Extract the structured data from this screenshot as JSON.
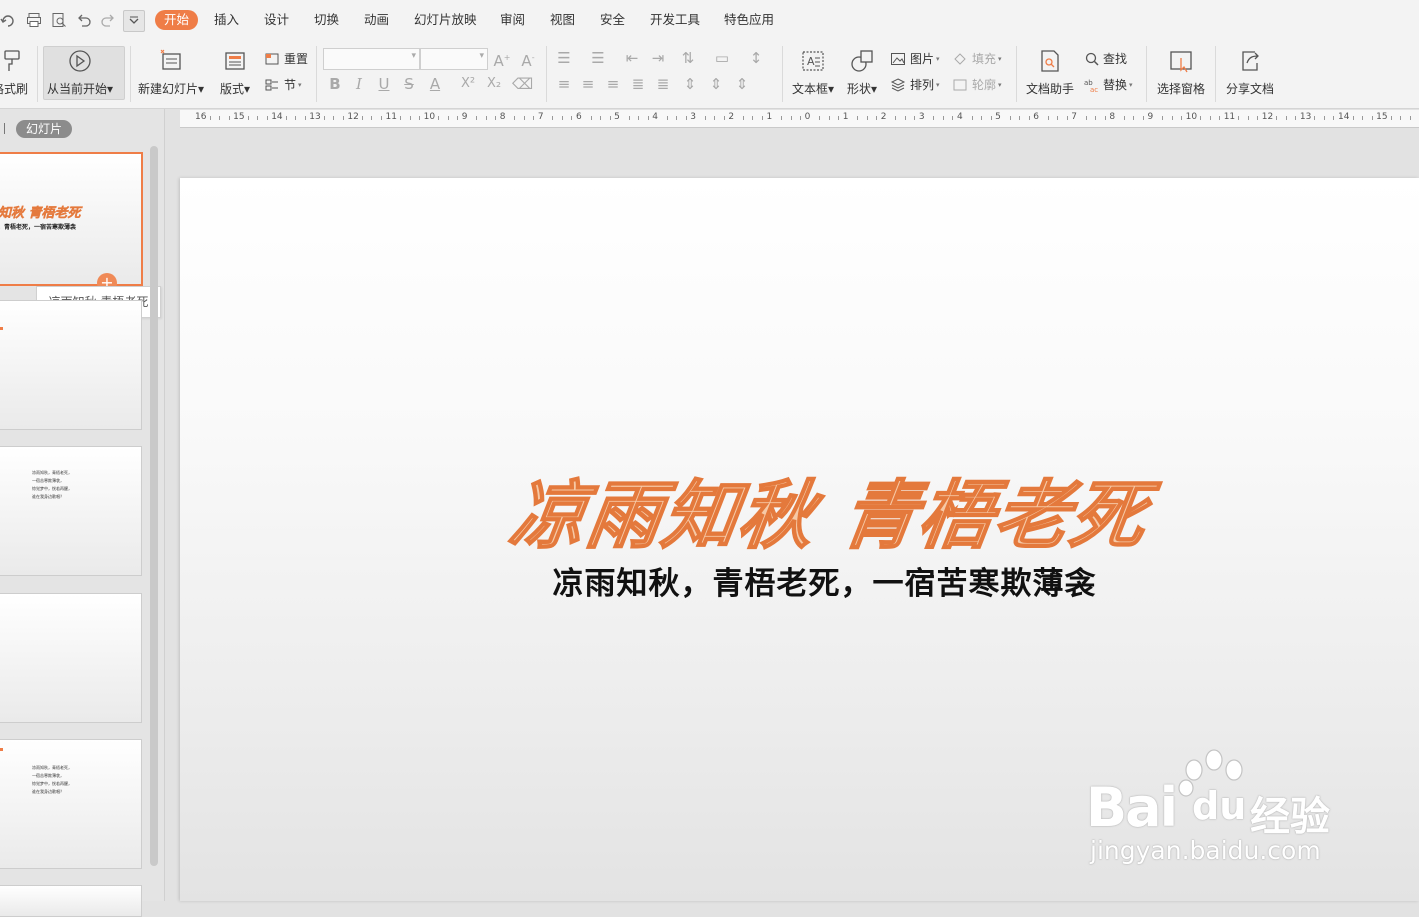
{
  "menubar": {
    "tabs": [
      "开始",
      "插入",
      "设计",
      "切换",
      "动画",
      "幻灯片放映",
      "审阅",
      "视图",
      "安全",
      "开发工具",
      "特色应用"
    ],
    "active_tab": "开始",
    "accent": "#ef7d47"
  },
  "ribbon": {
    "format_painter": "格式刷",
    "from_current": "从当前开始",
    "new_slide": "新建幻灯片",
    "layout": "版式",
    "reset": "重置",
    "section": "节",
    "text_box": "文本框",
    "shape": "形状",
    "picture": "图片",
    "arrange": "排列",
    "fill": "填充",
    "outline": "轮廓",
    "doc_assistant": "文档助手",
    "find": "查找",
    "replace": "替换",
    "selection_pane": "选择窗格",
    "share_doc": "分享文档",
    "font_name": "",
    "font_size": ""
  },
  "panel": {
    "tab_outline": "",
    "tab_slides": "幻灯片",
    "tooltip": "凉雨知秋 青梧老死"
  },
  "thumbnails": {
    "t1_title": "知秋 青梧老死",
    "t1_sub": "，青梧老死，一宿苦寒欺薄衾",
    "list_lines": [
      "凉雨知秋，青梧老死，",
      "一宿苦寒欺薄衾，",
      "惊觉梦中，恍若再醒，",
      "谁在我身边歌唱？"
    ]
  },
  "ruler": {
    "labels": [
      "16",
      "15",
      "14",
      "13",
      "12",
      "11",
      "10",
      "9",
      "8",
      "7",
      "6",
      "5",
      "4",
      "3",
      "2",
      "1",
      "0",
      "1",
      "2",
      "3",
      "4",
      "5",
      "6",
      "7",
      "8",
      "9",
      "10",
      "11",
      "12",
      "13",
      "14",
      "15"
    ]
  },
  "slide": {
    "title": "凉雨知秋 青梧老死",
    "subtitle": "凉雨知秋，青梧老死，一宿苦寒欺薄衾",
    "title_color": "#e4793c"
  },
  "watermark": {
    "brand": "Bai",
    "brand2": "du",
    "cn": "经验",
    "url": "jingyan.baidu.com"
  }
}
